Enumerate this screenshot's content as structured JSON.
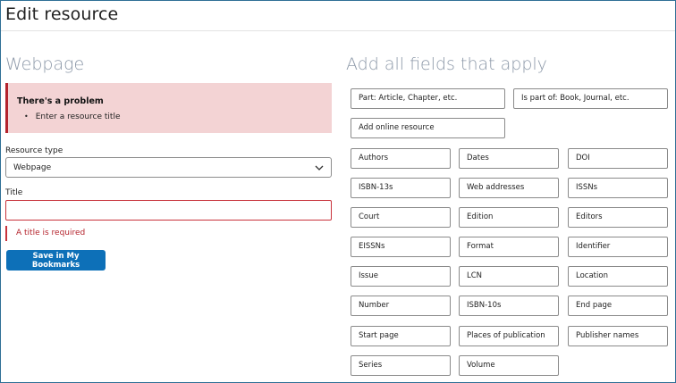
{
  "page": {
    "title": "Edit resource"
  },
  "left": {
    "heading": "Webpage",
    "error_summary": {
      "heading": "There's a problem",
      "items": [
        "Enter a resource title"
      ]
    },
    "resource_type": {
      "label": "Resource type",
      "value": "Webpage"
    },
    "title_field": {
      "label": "Title",
      "value": "",
      "error": "A title is required"
    },
    "save_label": "Save in My Bookmarks"
  },
  "right": {
    "heading": "Add all fields that apply",
    "wide_buttons": [
      "Part: Article, Chapter, etc.",
      "Is part of: Book, Journal, etc.",
      "Add online resource"
    ],
    "fields": [
      "Authors",
      "Dates",
      "DOI",
      "ISBN-13s",
      "Web addresses",
      "ISSNs",
      "Court",
      "Edition",
      "Editors",
      "EISSNs",
      "Format",
      "Identifier",
      "Issue",
      "LCN",
      "Location",
      "Number",
      "ISBN-10s",
      "End page",
      "Start page",
      "Places of publication",
      "Publisher names",
      "Series",
      "Volume"
    ]
  },
  "colors": {
    "accent": "#0d70b8",
    "error": "#b4232c",
    "error_bg": "#f3d3d4",
    "muted_heading": "#8c98a8"
  }
}
